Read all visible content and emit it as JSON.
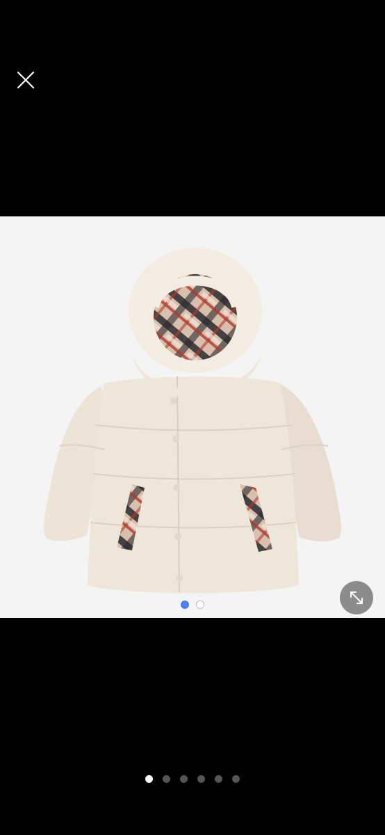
{
  "viewer": {
    "close_icon": "close-icon",
    "expand_icon": "expand-diagonal-icon",
    "product_image": "hooded-puffer-jacket",
    "image_dots": {
      "count": 2,
      "active_index": 0,
      "active_color": "#4e7ded"
    },
    "gallery_dots": {
      "count": 6,
      "active_index": 0
    }
  },
  "colors": {
    "background": "#000000",
    "panel": "#f4f4f4",
    "jacket": "#ede3d7",
    "expand_button": "#8c8c8c"
  }
}
